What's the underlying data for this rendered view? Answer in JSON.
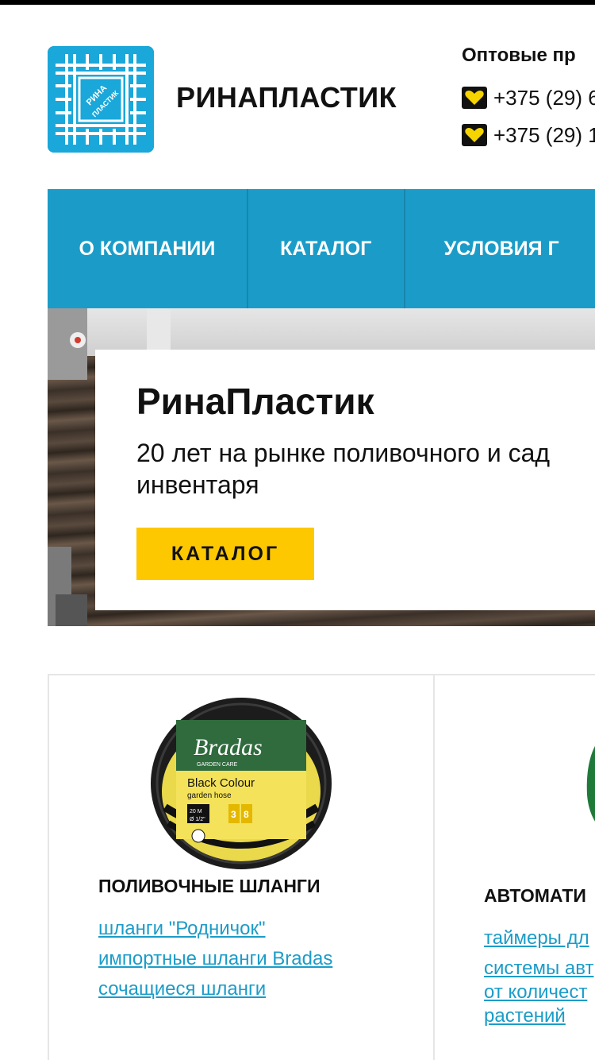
{
  "header": {
    "brand_name": "РИНАПЛАСТИК",
    "logo_text_line1": "РИНА",
    "logo_text_line2": "ПЛАСТИК",
    "wholesale_label": "Оптовые пр",
    "phones": [
      "+375 (29) 6",
      "+375 (29) 1"
    ],
    "phone_icon": "velcom-heart-icon"
  },
  "nav": {
    "items": [
      "О КОМПАНИИ",
      "КАТАЛОГ",
      "УСЛОВИЯ Г"
    ]
  },
  "hero": {
    "title": "РинаПластик",
    "subtitle": "20 лет на рынке поливочного и сад инвентаря",
    "button_label": "КАТАЛОГ"
  },
  "categories": [
    {
      "title": "ПОЛИВОЧНЫЕ ШЛАНГИ",
      "image_icon": "garden-hose-image",
      "product_text": {
        "brand": "Bradas",
        "brand_sub": "GARDEN CARE",
        "product": "Black Colour",
        "product_sub": "garden hose",
        "length": "20 M",
        "diameter": "Ø 1/2\"",
        "badge1": "3",
        "badge2": "8"
      },
      "links": [
        "шланги \"Родничок\"",
        "импортные шланги Bradas",
        "сочащиеся шланги"
      ]
    },
    {
      "title": "АВТОМАТИ",
      "image_icon": "water-timer-image",
      "links": [
        "таймеры дл",
        "системы авт от количест растений"
      ]
    }
  ],
  "colors": {
    "accent": "#1b9cc8",
    "button": "#fdc800",
    "logo_bg": "#1aa7d9",
    "link": "#1b9cc8"
  }
}
